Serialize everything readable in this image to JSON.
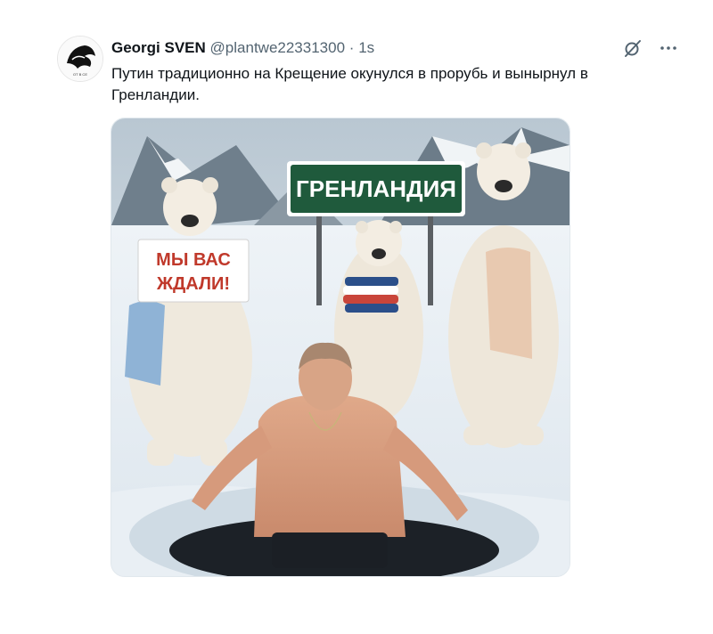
{
  "post": {
    "author_name": "Georgi SVEN",
    "author_handle": "@plantwe22331300",
    "separator": "·",
    "timestamp": "1s",
    "text": "Путин традиционно на Крещение окунулся в прорубь и вынырнул в Гренландии."
  },
  "actions": [
    {
      "icon": "grok-slash-icon"
    },
    {
      "icon": "more-options-icon"
    }
  ],
  "media": {
    "sign_text": "ГРЕНЛАНДИЯ",
    "placard_line1": "МЫ ВАС",
    "placard_line2": "ЖДАЛИ!",
    "avatar_caption": "ОТ В СЕ"
  },
  "colors": {
    "text_primary": "#0f1419",
    "text_secondary": "#536471",
    "sign_green": "#1f5a3c",
    "placard_red": "#c0392b"
  }
}
